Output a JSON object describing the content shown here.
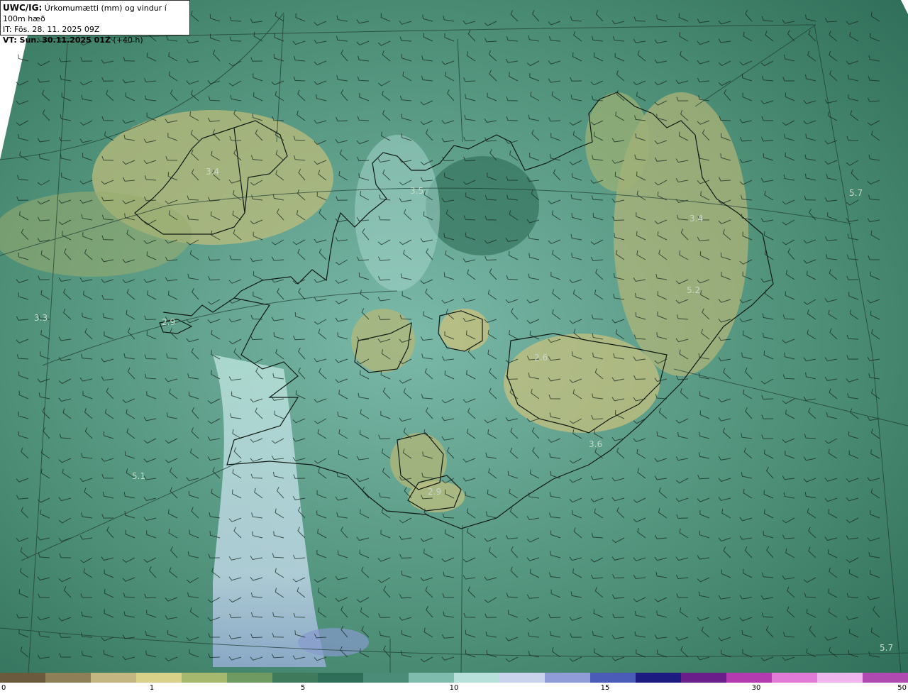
{
  "header": {
    "model": "UWC/IG:",
    "title": " Úrkomumætti (mm) og vindur í 100m hæð",
    "init_time": "IT: Fös. 28. 11. 2025 09Z",
    "valid_label": "VT: Sun. 30.11.2025 01Z",
    "lead_time": " (+40 h)"
  },
  "map_labels": [
    "3.4",
    "5.7",
    "2.9",
    "3.3",
    "2.6",
    "5.2",
    "5.1",
    "2.9",
    "5.7",
    "3.5",
    "3.6"
  ],
  "colorbar": {
    "ticks": [
      "0",
      "1",
      "5",
      "10",
      "15",
      "30",
      "50"
    ],
    "colors": [
      "#6b5a3e",
      "#8f7f58",
      "#c4b680",
      "#d9d18a",
      "#a6b86e",
      "#6f9a62",
      "#3f7a5c",
      "#2f6f5a",
      "#4a8c78",
      "#7fbcae",
      "#b8e0da",
      "#c9d4ec",
      "#8f9cd8",
      "#4a5bb8",
      "#1c1c80",
      "#6a1e8a",
      "#b43ab0",
      "#e27ad8",
      "#f0b6ec",
      "#b04ab0"
    ]
  }
}
